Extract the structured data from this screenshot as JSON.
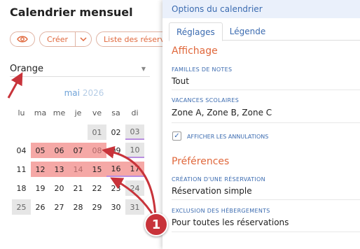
{
  "header": {
    "title": "Calendrier mensuel"
  },
  "toolbar": {
    "eye_icon": "eye-icon",
    "create_label": "Créer",
    "create_dropdown_icon": "chevron-down-icon",
    "list_label": "Liste des réserv"
  },
  "filter": {
    "selected": "Orange",
    "caret_icon": "chevron-down-icon"
  },
  "calendar": {
    "month": "mai",
    "year": "2026",
    "weekdays": [
      "lu",
      "ma",
      "me",
      "je",
      "ve",
      "sa",
      "di"
    ],
    "days": [
      "01",
      "02",
      "03",
      "04",
      "05",
      "06",
      "07",
      "08",
      "09",
      "10",
      "11",
      "12",
      "13",
      "14",
      "15",
      "16",
      "17",
      "18",
      "19",
      "20",
      "21",
      "22",
      "23",
      "24",
      "25",
      "26",
      "27",
      "28",
      "29",
      "30",
      "31"
    ]
  },
  "panel": {
    "title": "Options du calendrier",
    "tabs": [
      "Réglages",
      "Légende"
    ],
    "section_display": "Affichage",
    "note_families_label": "FAMILLES DE NOTES",
    "note_families_value": "Tout",
    "school_holidays_label": "VACANCES SCOLAIRES",
    "school_holidays_value": "Zone A, Zone B, Zone C",
    "show_cancellations_label": "AFFICHER LES ANNULATIONS",
    "show_cancellations_checked": true,
    "section_prefs": "Préférences",
    "reservation_creation_label": "CRÉATION D'UNE RÉSERVATION",
    "reservation_creation_value": "Réservation simple",
    "exclusion_label": "EXCLUSION DES HÉBERGEMENTS",
    "exclusion_value": "Pour toutes les réservations"
  },
  "annotation": {
    "badge_number": "1",
    "color": "#c8333a"
  }
}
